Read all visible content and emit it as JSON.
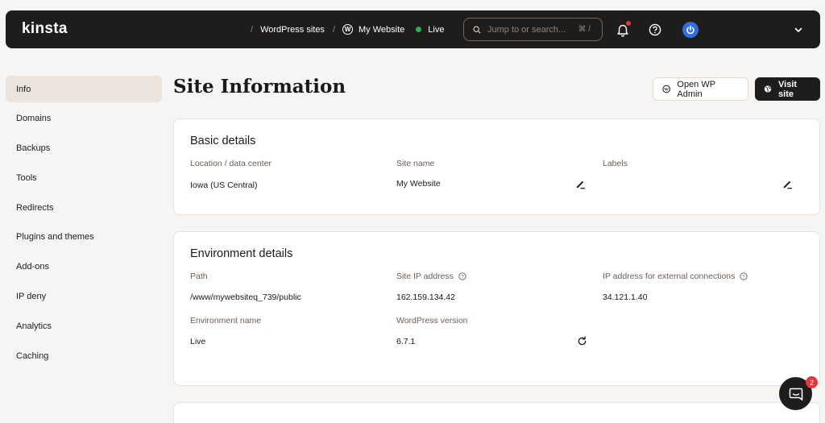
{
  "header": {
    "logo": "kinsta",
    "breadcrumbs": [
      {
        "label": "WordPress sites"
      },
      {
        "label": "My Website"
      }
    ],
    "status": "Live",
    "search": {
      "placeholder": "Jump to or search...",
      "shortcut": "⌘ /"
    }
  },
  "sidebar": {
    "items": [
      {
        "label": "Info",
        "active": true
      },
      {
        "label": "Domains"
      },
      {
        "label": "Backups"
      },
      {
        "label": "Tools"
      },
      {
        "label": "Redirects"
      },
      {
        "label": "Plugins and themes"
      },
      {
        "label": "Add-ons"
      },
      {
        "label": "IP deny"
      },
      {
        "label": "Analytics"
      },
      {
        "label": "Caching"
      }
    ]
  },
  "page": {
    "title": "Site Information",
    "open_wp_admin": "Open WP Admin",
    "visit_site": "Visit site"
  },
  "basic": {
    "title": "Basic details",
    "location_label": "Location / data center",
    "location_value": "Iowa (US Central)",
    "site_name_label": "Site name",
    "site_name_value": "My Website",
    "labels_label": "Labels"
  },
  "environment": {
    "title": "Environment details",
    "path_label": "Path",
    "path_value": "/www/mywebsiteq_739/public",
    "ip_label": "Site IP address",
    "ip_value": "162.159.134.42",
    "ext_ip_label": "IP address for external connections",
    "ext_ip_value": "34.121.1.40",
    "env_name_label": "Environment name",
    "env_name_value": "Live",
    "wp_version_label": "WordPress version",
    "wp_version_value": "6.7.1"
  },
  "chat": {
    "badge": "2"
  },
  "colors": {
    "live": "#21b354",
    "dark": "#1f1d1c",
    "active_bg": "#ebe3dc",
    "notify": "#e8343b"
  }
}
